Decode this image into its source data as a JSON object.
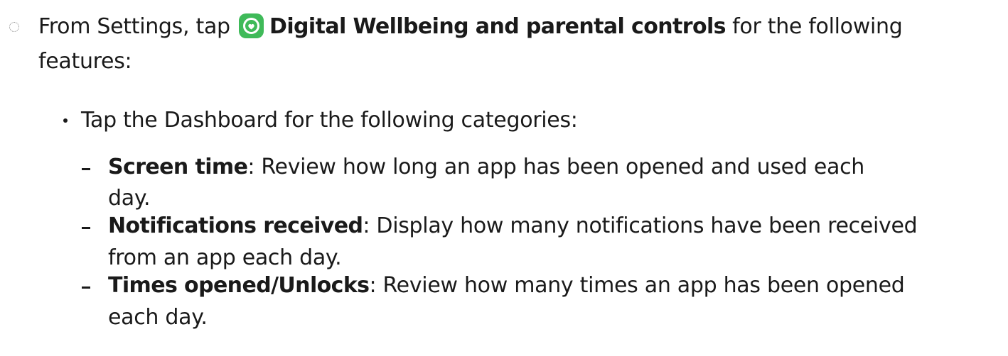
{
  "step": {
    "intro": "From Settings, tap",
    "app_icon": "digital-wellbeing-icon",
    "app_name": "Digital Wellbeing and parental controls",
    "suffix": "for the following",
    "line2": "features:"
  },
  "bullet": {
    "text": "Tap the Dashboard for the following categories:"
  },
  "items": [
    {
      "term": "Screen time",
      "line1": ": Review how long an app has been opened and used each",
      "line2": "day."
    },
    {
      "term": "Notifications received",
      "line1": ": Display how many notifications have been received",
      "line2": "from an app each day."
    },
    {
      "term": "Times opened/Unlocks",
      "line1": ": Review how many times an app has been opened",
      "line2": "each day."
    }
  ],
  "colors": {
    "icon_green": "#3fba59",
    "text": "#1a1a1a"
  }
}
